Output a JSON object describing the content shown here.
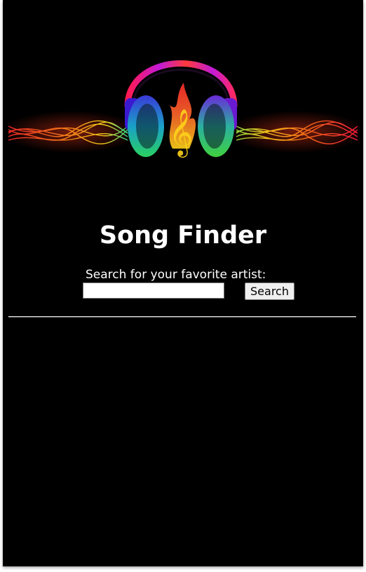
{
  "banner": {
    "image": "headphones-music-banner"
  },
  "page": {
    "title": "Song Finder",
    "background_color": "#000000",
    "text_color": "#ffffff"
  },
  "search": {
    "label": "Search for your favorite artist:",
    "input_value": "",
    "placeholder": "",
    "button_label": "Search"
  }
}
